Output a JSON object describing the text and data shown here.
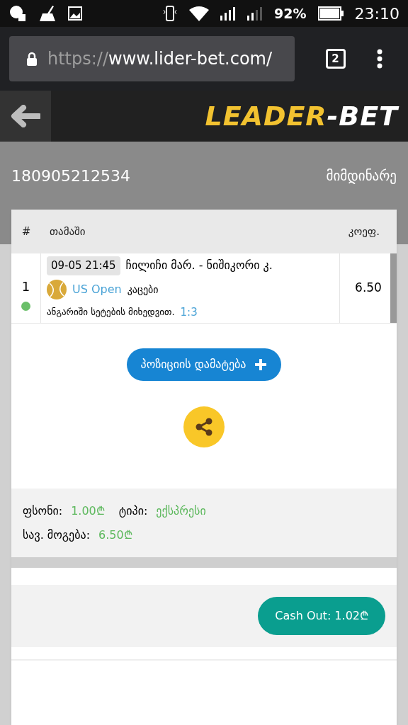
{
  "status_bar": {
    "battery": "92%",
    "time": "23:10"
  },
  "browser": {
    "url_scheme": "https://",
    "url_host": "www.lider-bet.com/",
    "tab_count": "2"
  },
  "header": {
    "logo_left": "LEADER",
    "logo_right": "-BET"
  },
  "ticket": {
    "id": "180905212534",
    "status": "მიმდინარე"
  },
  "table": {
    "columns": [
      "#",
      "თამაში",
      "კოეფ."
    ],
    "rows": [
      {
        "number": "1",
        "color": "#6abf69",
        "datetime": "09-05 21:45",
        "match": "ჩილიჩი მარ. - ნიშიკორი კ.",
        "tournament": "US Open",
        "category": "კაცები",
        "market": "ანგარიში სეტების მიხედვით.",
        "pick": "1:3",
        "odds": "6.50"
      }
    ]
  },
  "add_button": "პოზიციის დამატება",
  "summary": {
    "stake_label": "ფსონი:",
    "stake": "1.00₾",
    "type_label": "ტიპი:",
    "type": "ექსპრესი",
    "win_label": "სავ. მოგება:",
    "win": "6.50₾"
  },
  "cashout_button": "Cash Out: 1.02₾"
}
